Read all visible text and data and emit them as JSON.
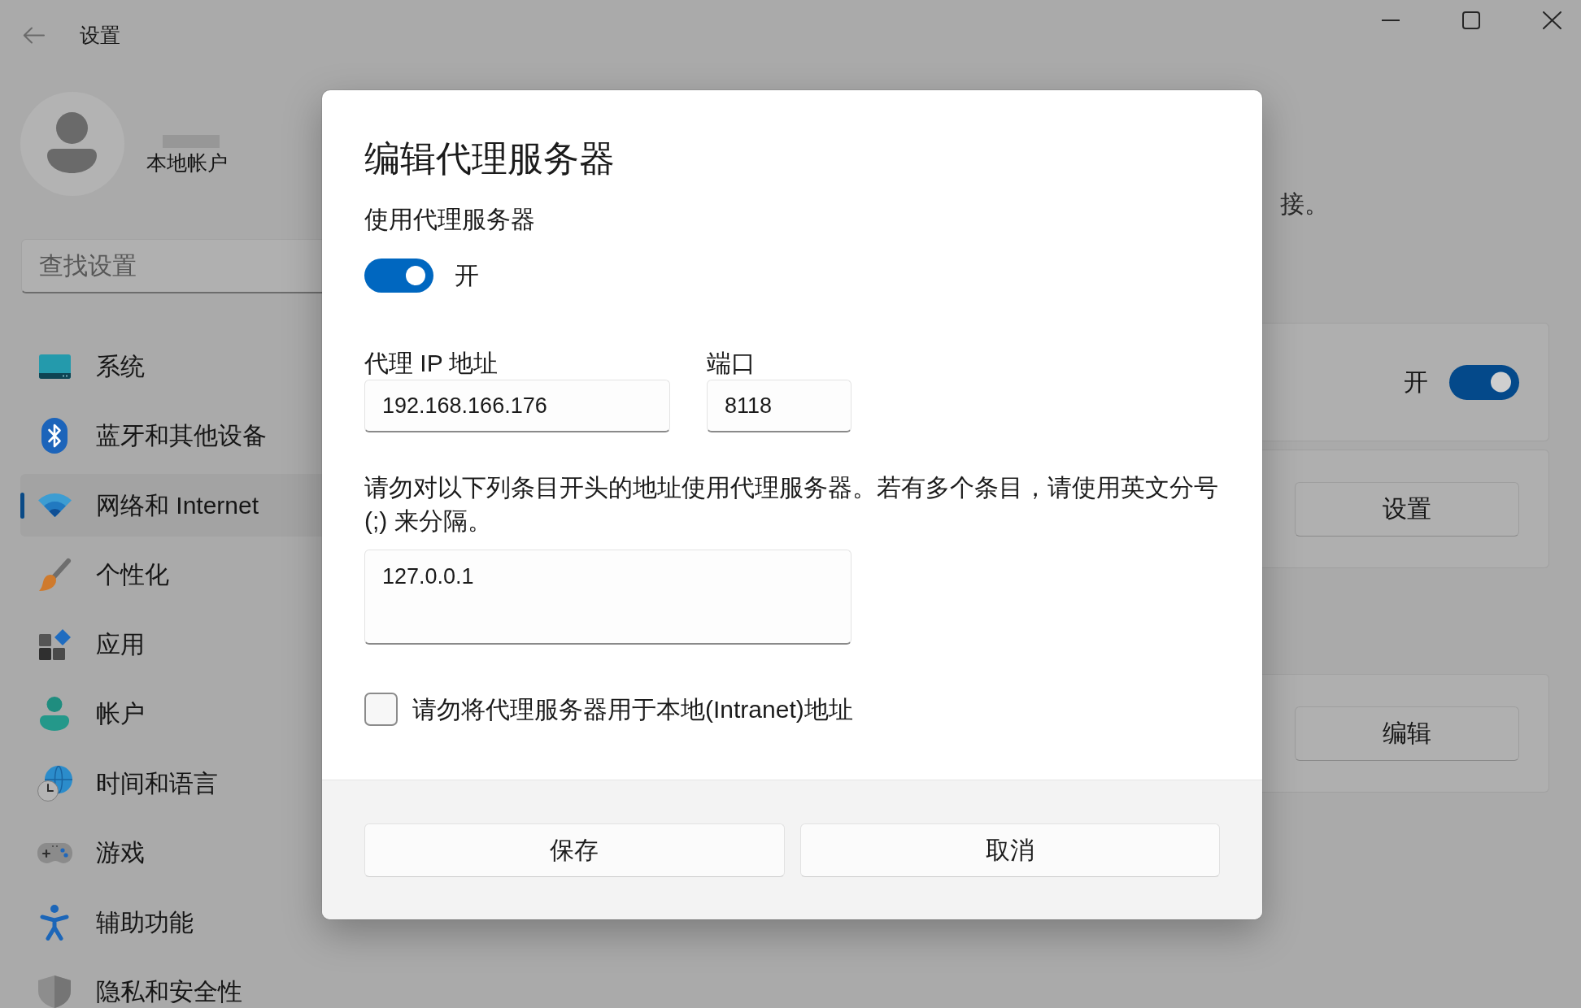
{
  "window": {
    "title": "设置"
  },
  "account": {
    "type": "本地帐户"
  },
  "search": {
    "placeholder": "查找设置"
  },
  "sidebar": {
    "items": [
      {
        "label": "系统",
        "selected": false
      },
      {
        "label": "蓝牙和其他设备",
        "selected": false
      },
      {
        "label": "网络和 Internet",
        "selected": true
      },
      {
        "label": "个性化",
        "selected": false
      },
      {
        "label": "应用",
        "selected": false
      },
      {
        "label": "帐户",
        "selected": false
      },
      {
        "label": "时间和语言",
        "selected": false
      },
      {
        "label": "游戏",
        "selected": false
      },
      {
        "label": "辅助功能",
        "selected": false
      },
      {
        "label": "隐私和安全性",
        "selected": false
      }
    ]
  },
  "content": {
    "description": "接。",
    "cards": [
      {
        "kind": "toggle",
        "state_label": "开",
        "on": true
      },
      {
        "kind": "button",
        "button": "设置"
      },
      {
        "kind": "button",
        "button": "编辑"
      }
    ]
  },
  "dialog": {
    "title": "编辑代理服务器",
    "use_proxy": {
      "label": "使用代理服务器",
      "on": true,
      "state_label": "开"
    },
    "address": {
      "label": "代理 IP 地址",
      "value": "192.168.166.176"
    },
    "port": {
      "label": "端口",
      "value": "8118"
    },
    "exceptions": {
      "description": "请勿对以下列条目开头的地址使用代理服务器。若有多个条目，请使用英文分号 (;) 来分隔。",
      "value": "127.0.0.1"
    },
    "bypass_local": {
      "label": "请勿将代理服务器用于本地(Intranet)地址",
      "checked": false
    },
    "buttons": [
      "保存",
      "取消"
    ]
  }
}
